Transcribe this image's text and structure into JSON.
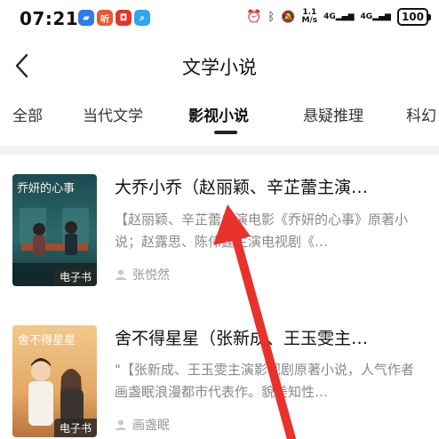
{
  "status_bar": {
    "time": "07:21",
    "net_speed": "1.1",
    "net_unit": "M/s",
    "signal_1": "4G",
    "signal_2": "4G",
    "battery": "100"
  },
  "header": {
    "title": "文学小说"
  },
  "tabs": [
    {
      "label": "全部"
    },
    {
      "label": "当代文学"
    },
    {
      "label": "影视小说",
      "active": true
    },
    {
      "label": "悬疑推理"
    },
    {
      "label": "科幻"
    }
  ],
  "books": [
    {
      "title": "大乔小乔（赵丽颖、辛芷蕾主演…",
      "description": "【赵丽颖、辛芷蕾主演电影《乔妍的心事》原著小说；赵露思、陈伟霆主演电视剧《…",
      "author": "张悦然",
      "badge": "电子书",
      "cover_title": "乔妍的心事"
    },
    {
      "title": "舍不得星星（张新成、王玉雯主…",
      "description": "\"【张新成、王玉雯主演影视剧原著小说，人气作者画盏眠浪漫都市代表作。貌美知性…",
      "author": "画盏眠",
      "badge": "电子书",
      "cover_title": "舍不得星星"
    }
  ],
  "colors": {
    "annotation_arrow": "#e8322b",
    "tab_indicator": "#222222"
  }
}
